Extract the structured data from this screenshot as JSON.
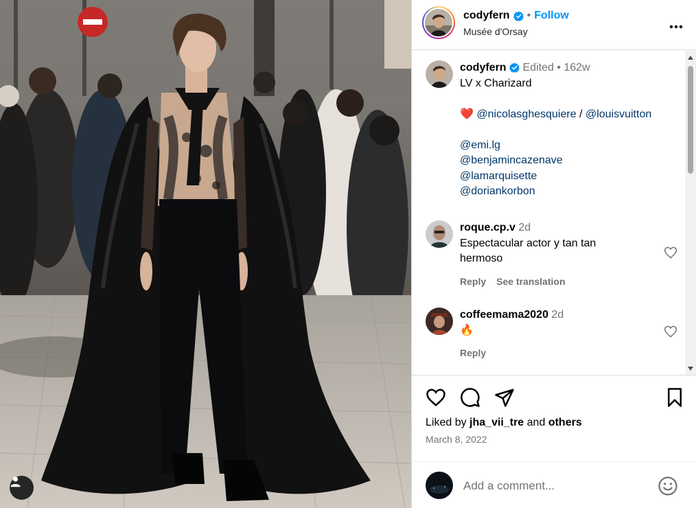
{
  "header": {
    "username": "cody fern",
    "username_display": "codyfern",
    "follow_label": "Follow",
    "location": "Musée d'Orsay",
    "more_icon": "more-horizontal-icon"
  },
  "caption": {
    "username": "codyfern",
    "edited": "Edited",
    "age": "162w",
    "title": "LV x Charizard",
    "mention1": "@nicolasghesquiere",
    "slash": "/",
    "mention2": "@louisvuitton",
    "credits": [
      "@emi.lg",
      "@benjamincazenave",
      "@lamarquisette",
      "@doriankorbon"
    ]
  },
  "comments": [
    {
      "username": "roque.cp.v",
      "age": "2d",
      "text": "Espectacular actor y tan tan hermoso",
      "reply": "Reply",
      "translate": "See translation"
    },
    {
      "username": "coffeemama2020",
      "age": "2d",
      "text": "🔥",
      "reply": "Reply"
    }
  ],
  "footer": {
    "liked_prefix": "Liked by",
    "liked_user": "jha_vii_tre",
    "liked_and": "and",
    "liked_others": "others",
    "date": "March 8, 2022",
    "add_comment_placeholder": "Add a comment..."
  },
  "colors": {
    "link": "#00376b",
    "follow": "#0095f6",
    "meta": "#737373",
    "heart": "#ed4956"
  }
}
